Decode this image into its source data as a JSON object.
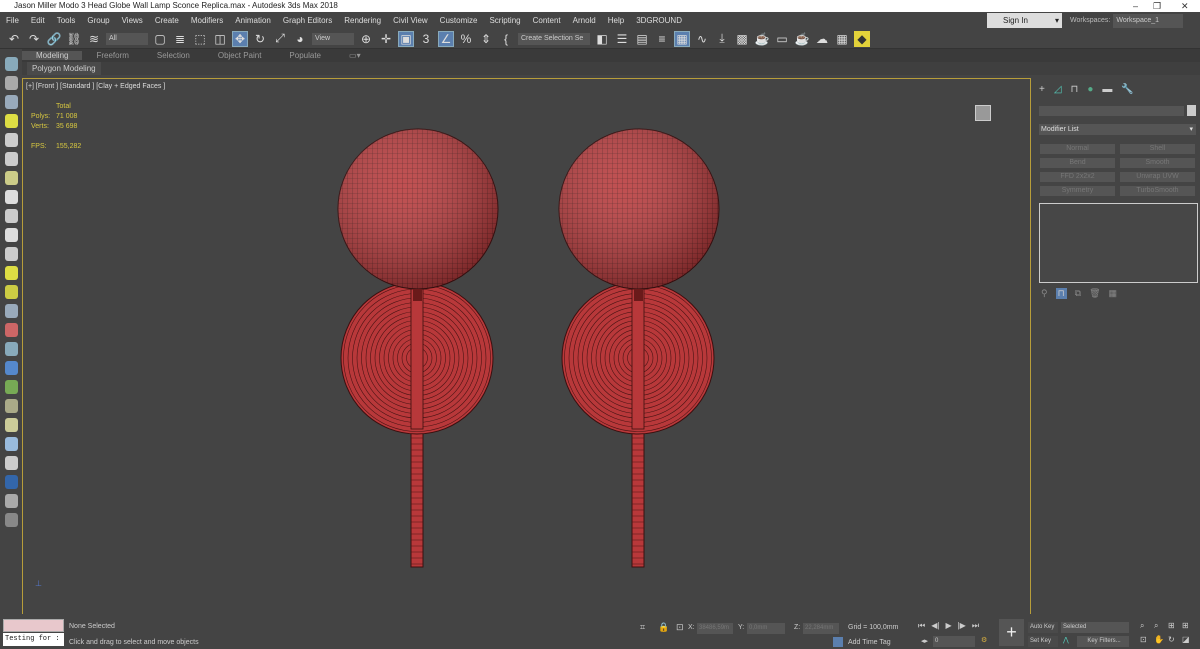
{
  "window": {
    "title": "Jason Miller Modo 3 Head Globe Wall Lamp Sconce Replica.max - Autodesk 3ds Max 2018",
    "minimize": "–",
    "restore": "❐",
    "close": "✕"
  },
  "menu": [
    "File",
    "Edit",
    "Tools",
    "Group",
    "Views",
    "Create",
    "Modifiers",
    "Animation",
    "Graph Editors",
    "Rendering",
    "Civil View",
    "Customize",
    "Scripting",
    "Content",
    "Arnold",
    "Help",
    "3DGROUND"
  ],
  "account": {
    "sign_in": "Sign In",
    "workspaces_label": "Workspaces:",
    "workspace": "Workspace_1"
  },
  "toolbar": {
    "selection_filter": "All",
    "ref_coord": "View",
    "named_selection": "Create Selection Se"
  },
  "ribbon": {
    "tabs": [
      "Modeling",
      "Freeform",
      "Selection",
      "Object Paint",
      "Populate"
    ],
    "active": "Modeling",
    "panel": "Polygon Modeling"
  },
  "viewport": {
    "label": "[+] [Front ] [Standard ] [Clay + Edged Faces ]",
    "stats": {
      "total_label": "Total",
      "polys_label": "Polys:",
      "polys": "71 008",
      "verts_label": "Verts:",
      "verts": "35 698",
      "fps_label": "FPS:",
      "fps": "155,282"
    },
    "mesh_color": "#b8383a"
  },
  "command_panel": {
    "modifier_list": "Modifier List",
    "buttons": [
      "Normal",
      "Shell",
      "Bend",
      "Smooth",
      "FFD 2x2x2",
      "Unwrap UVW",
      "Symmetry",
      "TurboSmooth"
    ]
  },
  "status": {
    "script_listener": "Testing for :",
    "selection": "None Selected",
    "prompt": "Click and drag to select and move objects",
    "x_label": "X:",
    "x": "38486,59m",
    "y_label": "Y:",
    "y": "0,0mm",
    "z_label": "Z:",
    "z": "22,284mm",
    "grid": "Grid = 100,0mm",
    "add_time_tag": "Add Time Tag",
    "frame": "0",
    "auto_key": "Auto Key",
    "set_key": "Set Key",
    "key_mode": "Selected",
    "key_filters": "Key Filters..."
  }
}
